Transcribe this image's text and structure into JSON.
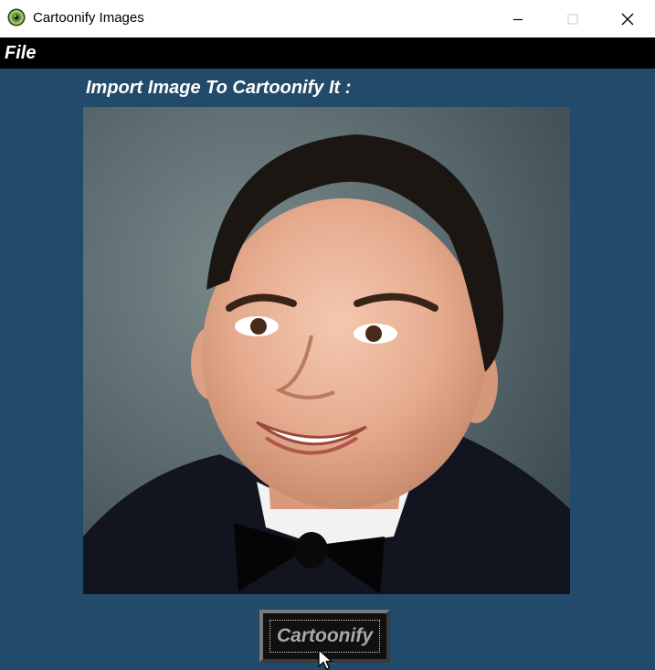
{
  "window": {
    "title": "Cartoonify Images",
    "app_icon": "green-eye-icon",
    "controls": [
      "minimize-icon",
      "maximize-icon",
      "close-icon"
    ]
  },
  "menu": {
    "items": [
      {
        "label": "File"
      }
    ]
  },
  "main": {
    "heading": "Import Image To Cartoonify It :",
    "image": {
      "subject": "portrait photo of a smiling man in a black tuxedo with bow tie"
    },
    "cartoonify_button": {
      "label": "Cartoonify"
    }
  },
  "colors": {
    "content_background": "#224a6a",
    "menu_background": "#000000",
    "button_background": "#101010",
    "button_text": "#a9a9a9"
  }
}
